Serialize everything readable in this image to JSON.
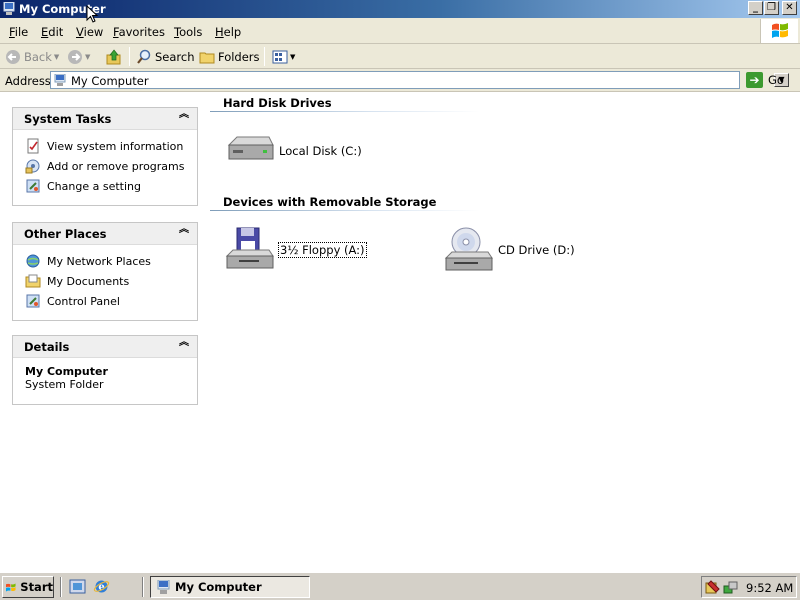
{
  "window": {
    "title": "My Computer",
    "buttons": {
      "minimize": "_",
      "maximize": "❐",
      "close": "✕"
    }
  },
  "menu": [
    {
      "label": "File",
      "key": "F",
      "rest": "ile"
    },
    {
      "label": "Edit",
      "key": "E",
      "rest": "dit"
    },
    {
      "label": "View",
      "key": "V",
      "rest": "iew"
    },
    {
      "label": "Favorites",
      "key": "F",
      "rest": "avorites"
    },
    {
      "label": "Tools",
      "key": "T",
      "rest": "ools"
    },
    {
      "label": "Help",
      "key": "H",
      "rest": "elp"
    }
  ],
  "toolbar": {
    "back": "Back",
    "search": "Search",
    "folders": "Folders"
  },
  "address": {
    "label": "Address",
    "value": "My Computer",
    "go": "Go"
  },
  "panels": {
    "system_tasks": {
      "title": "System Tasks",
      "items": [
        "View system information",
        "Add or remove programs",
        "Change a setting"
      ]
    },
    "other_places": {
      "title": "Other Places",
      "items": [
        "My Network Places",
        "My Documents",
        "Control Panel"
      ]
    },
    "details": {
      "title": "Details",
      "name": "My Computer",
      "type": "System Folder"
    }
  },
  "groups": {
    "hard_disks": {
      "title": "Hard Disk Drives",
      "items": [
        "Local Disk (C:)"
      ]
    },
    "removable": {
      "title": "Devices with Removable Storage",
      "items": [
        "3½ Floppy (A:)",
        "CD Drive (D:)"
      ]
    }
  },
  "taskbar": {
    "start": "Start",
    "task": "My Computer",
    "clock": "9:52 AM"
  },
  "colors": {
    "titlebar_start": "#0a246a",
    "titlebar_end": "#a6caf0",
    "chrome": "#ece9d8",
    "taskbar": "#d4d0c8"
  }
}
